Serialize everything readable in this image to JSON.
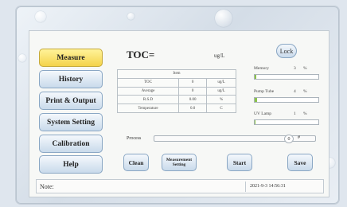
{
  "nav": {
    "items": [
      {
        "label": "Measure",
        "active": true
      },
      {
        "label": "History",
        "active": false
      },
      {
        "label": "Print & Output",
        "active": false
      },
      {
        "label": "System Setting",
        "active": false
      },
      {
        "label": "Calibration",
        "active": false
      },
      {
        "label": "Help",
        "active": false
      }
    ]
  },
  "header": {
    "toc_label": "TOC=",
    "toc_unit": "ug/L",
    "lock_label": "Lock"
  },
  "table": {
    "header": "Item",
    "rows": [
      {
        "name": "TOC",
        "value": "0",
        "unit": "ug/L"
      },
      {
        "name": "Average",
        "value": "0",
        "unit": "ug/L"
      },
      {
        "name": "R.S.D",
        "value": "0.00",
        "unit": "%"
      },
      {
        "name": "Temperature",
        "value": "0.0",
        "unit": "C"
      }
    ]
  },
  "status": {
    "memory": {
      "label": "Memory",
      "value": "3",
      "unit": "%",
      "level": 0.03
    },
    "pump_tube": {
      "label": "Pump Tube",
      "value": "4",
      "unit": "%",
      "level": 0.04
    },
    "uv_lamp": {
      "label": "UV Lamp",
      "value": "1",
      "unit": "%",
      "level": 0.01
    }
  },
  "process": {
    "label": "Process",
    "value": "0",
    "unit": "#",
    "level": 0
  },
  "actions": {
    "clean": "Clean",
    "measurement_setting_1": "Measurement",
    "measurement_setting_2": "Setting",
    "start": "Start",
    "save": "Save"
  },
  "footer": {
    "note_label": "Note:",
    "datetime": "2021-9-3 14:56:31"
  },
  "colors": {
    "active_nav": "#f4d34a",
    "button": "#c9daeb",
    "bar_fill": "#8bc34a"
  }
}
